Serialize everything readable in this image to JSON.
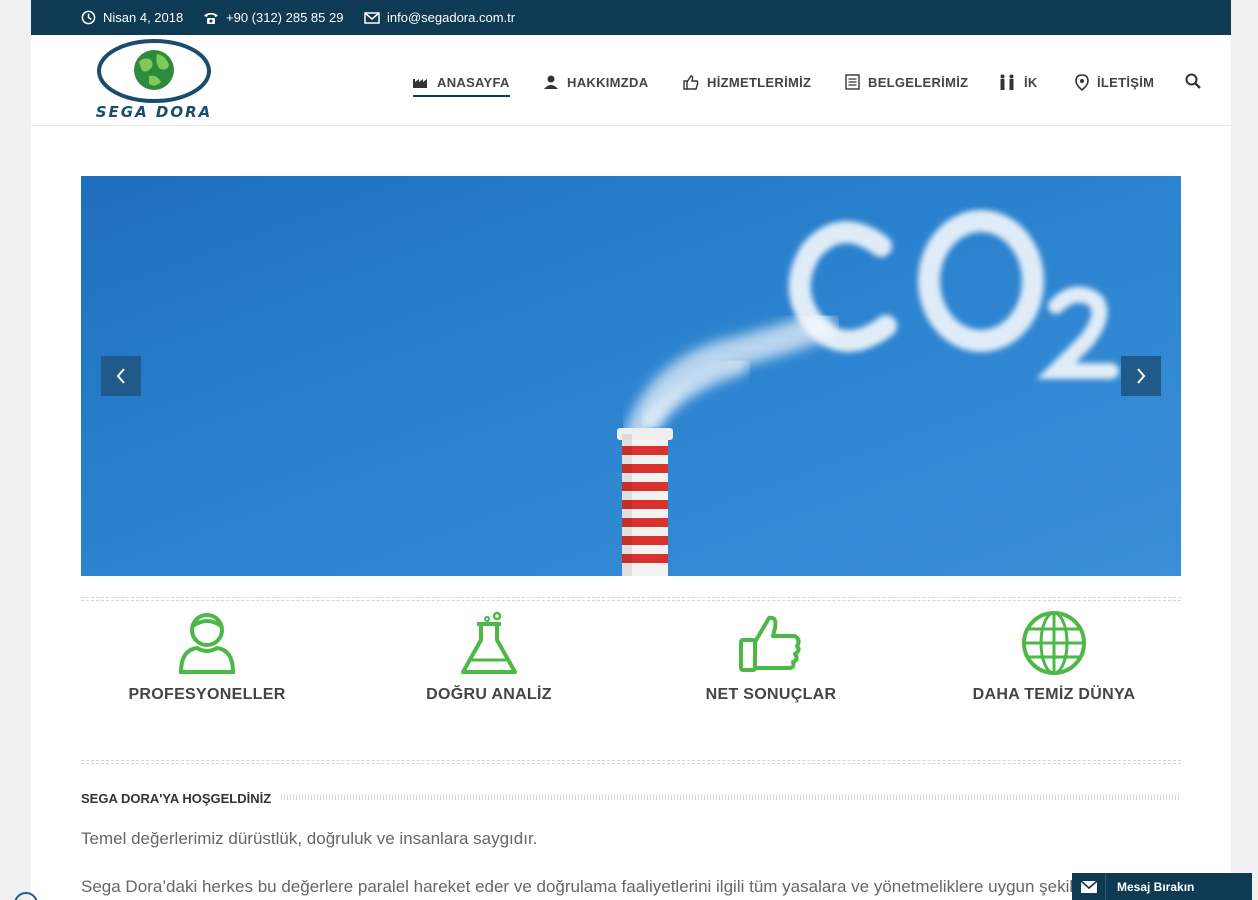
{
  "topbar": {
    "date": "Nisan 4, 2018",
    "phone": "+90 (312) 285 85 29",
    "email": "info@segadora.com.tr"
  },
  "logo": {
    "text": "SEGA DORA"
  },
  "nav": {
    "items": [
      {
        "label": "ANASAYFA",
        "icon": "factory-icon",
        "active": true
      },
      {
        "label": "HAKKIMZDA",
        "icon": "user-icon"
      },
      {
        "label": "HİZMETLERİMİZ",
        "icon": "thumbs-up-icon"
      },
      {
        "label": "BELGELERİMİZ",
        "icon": "document-icon"
      },
      {
        "label": "İK",
        "icon": "people-icon"
      },
      {
        "label": "İLETİŞİM",
        "icon": "location-pin-icon"
      }
    ]
  },
  "features": [
    {
      "label": "PROFESYONELLER",
      "icon": "professional-icon"
    },
    {
      "label": "DOĞRU ANALİZ",
      "icon": "flask-icon"
    },
    {
      "label": "NET SONUÇLAR",
      "icon": "thumbs-up-icon"
    },
    {
      "label": "DAHA TEMİZ DÜNYA",
      "icon": "globe-icon"
    }
  ],
  "welcome": {
    "title": "SEGA DORA'YA HOŞGELDİNİZ",
    "p1": "Temel değerlerimiz dürüstlük, doğruluk ve insanlara saygıdır.",
    "p2": "Sega Dora’daki herkes bu değerlere paralel hareket eder ve doğrulama faaliyetlerini ilgili tüm yasalara ve yönetmeliklere uygun şekilde"
  },
  "message_button": {
    "label": "Mesaj Bırakın"
  },
  "colors": {
    "brand": "#0e3a54",
    "accent": "#4cb848"
  }
}
